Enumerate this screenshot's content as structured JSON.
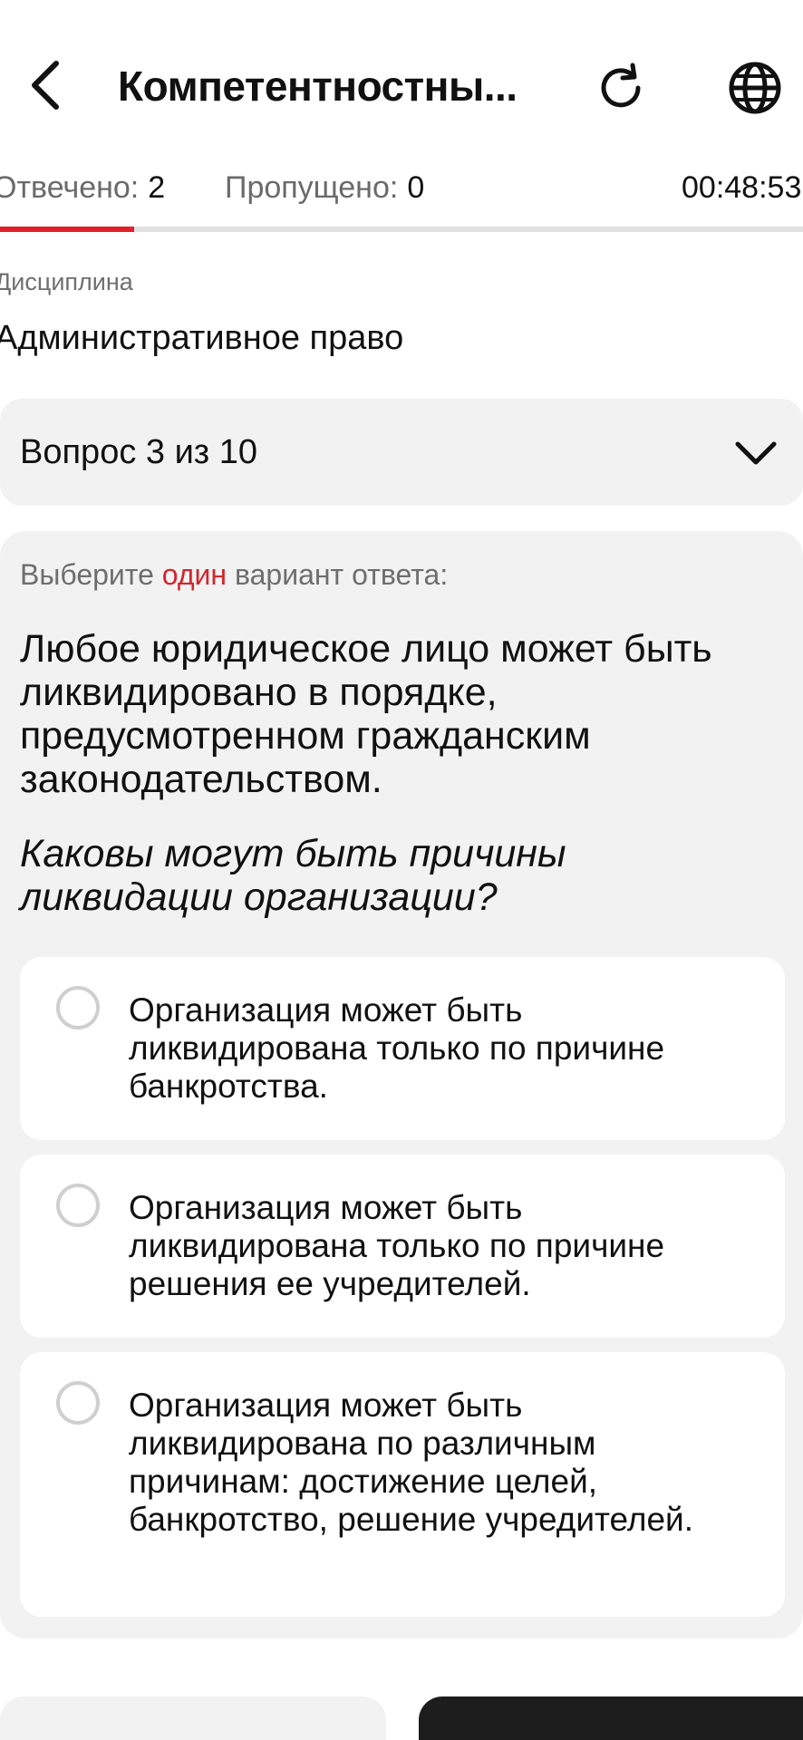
{
  "header": {
    "title": "Компетентностны...",
    "back_icon": "chevron-left-icon",
    "reload_icon": "reload-icon",
    "language_icon": "globe-icon"
  },
  "stats": {
    "answered_label": "Отвечено:",
    "answered_count": "2",
    "skipped_label": "Пропущено:",
    "skipped_count": "0",
    "timer": "00:48:53",
    "progress_fraction": 0.167
  },
  "discipline": {
    "label": "Дисциплина",
    "value": "Административное право"
  },
  "question_select": {
    "label": "Вопрос 3 из 10",
    "icon": "chevron-down-icon"
  },
  "question": {
    "instruction_prefix": "Выберите ",
    "instruction_accent": "один",
    "instruction_suffix": " вариант ответа:",
    "text": "Любое юридическое лицо может быть ликвидировано в порядке, предусмотренном гражданским законодательством.",
    "subtext": "Каковы могут быть причины ликвидации организации?",
    "options": [
      {
        "label": "Организация может быть ликвидирована только по причине банкротства."
      },
      {
        "label": "Организация может быть ликвидирована только по причине решения ее учредителей."
      },
      {
        "label": "Организация может быть ликвидирована по различным причинам: достижение целей, банкротство, решение учредителей."
      }
    ]
  },
  "colors": {
    "accent": "#e2202a",
    "card_bg": "#f2f2f2",
    "dark_button": "#1d1d1d"
  }
}
